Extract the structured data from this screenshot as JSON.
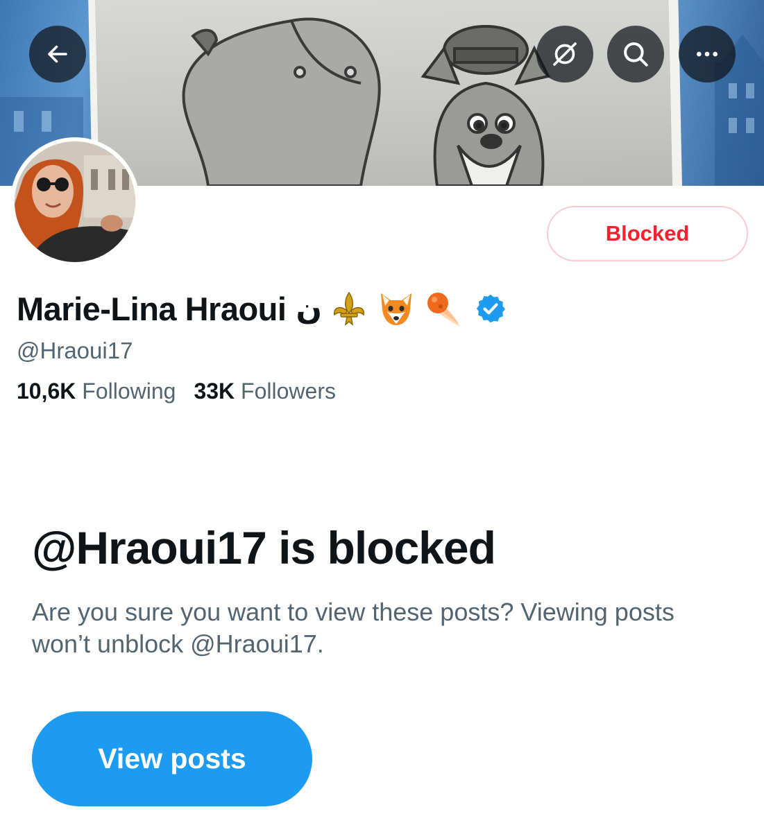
{
  "header": {
    "back_icon": "arrow-left-icon",
    "grok_icon": "grok-icon",
    "search_icon": "search-icon",
    "more_icon": "more-horizontal-icon"
  },
  "profile": {
    "display_name": "Marie-Lina Hraoui",
    "name_suffix_arabic": "ن",
    "name_emojis": [
      "fleur-de-lis",
      "fox-face",
      "comet"
    ],
    "verified": true,
    "handle": "@Hraoui17",
    "following_count": "10,6K",
    "following_label": "Following",
    "followers_count": "33K",
    "followers_label": "Followers",
    "action_button_label": "Blocked"
  },
  "blocked_notice": {
    "title": "@Hraoui17 is blocked",
    "message": "Are you sure you want to view these posts? Viewing posts won’t unblock @Hraoui17.",
    "button_label": "View posts"
  },
  "colors": {
    "blocked_red": "#f4212e",
    "blocked_border": "#fdc9ce",
    "primary_blue": "#1d9bf0",
    "verified_blue": "#1d9bf0",
    "secondary_text": "#536471",
    "primary_text": "#0f1419"
  }
}
